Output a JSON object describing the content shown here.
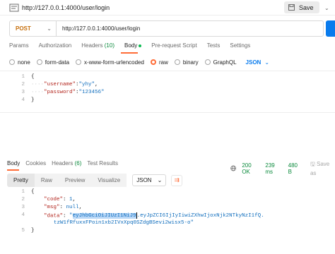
{
  "request": {
    "title": "http://127.0.0.1:4000/user/login",
    "save_label": "Save",
    "method": "POST",
    "url": "http://127.0.0.1:4000/user/login"
  },
  "req_tabs": {
    "params": "Params",
    "authorization": "Authorization",
    "headers": "Headers",
    "headers_count": "(10)",
    "body": "Body",
    "pre_request": "Pre-request Script",
    "tests": "Tests",
    "settings": "Settings"
  },
  "body_types": {
    "none": "none",
    "form_data": "form-data",
    "urlencoded": "x-www-form-urlencoded",
    "raw": "raw",
    "binary": "binary",
    "graphql": "GraphQL",
    "format": "JSON"
  },
  "editor": {
    "line_numbers": [
      "1",
      "2",
      "3",
      "4"
    ],
    "username_key": "\"username\"",
    "username_val": "\"yhy\"",
    "password_key": "\"password\"",
    "password_val": "\"123456\""
  },
  "resp_tabs": {
    "body": "Body",
    "cookies": "Cookies",
    "headers": "Headers",
    "headers_count": "(6)",
    "test_results": "Test Results"
  },
  "resp_status": {
    "status": "200 OK",
    "time": "239 ms",
    "size": "480 B",
    "save": "Save as"
  },
  "view_modes": {
    "pretty": "Pretty",
    "raw": "Raw",
    "preview": "Preview",
    "visualize": "Visualize",
    "format": "JSON"
  },
  "response": {
    "line_numbers": [
      "1",
      "2",
      "3",
      "4",
      "5"
    ],
    "code_key": "\"code\"",
    "code_val": "1",
    "msg_key": "\"msg\"",
    "msg_val": "null",
    "data_key": "\"data\"",
    "token_sel": "eyJhbGciOiJIUzI1NiJ9",
    "token_rest": ".eyJpZCI6IjIyIiwiZXhwIjoxNjk2NTkyNzI1fQ.",
    "token_line2": "tzW1fRfuxxFPoin1xb2IVxXpq0SZdgBSevi2wisx5-o\""
  },
  "colors": {
    "accent": "#ff6c37",
    "method": "#c66e0b",
    "status_ok": "#0b8a3c",
    "link_blue": "#097bed"
  }
}
